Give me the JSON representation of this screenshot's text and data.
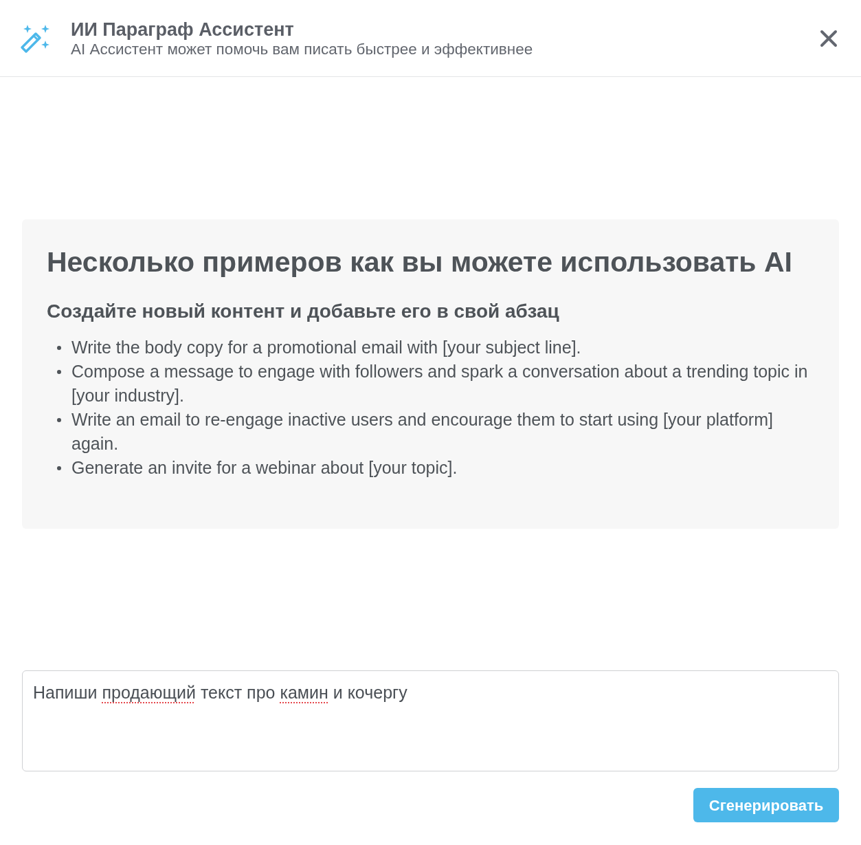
{
  "header": {
    "title": "ИИ Параграф Ассистент",
    "subtitle": "AI Ассистент может помочь вам писать быстрее и эффективнее"
  },
  "examples": {
    "title": "Несколько примеров как вы можете использовать AI",
    "subtitle": "Создайте новый контент и добавьте его в свой абзац",
    "items": [
      "Write the body copy for a promotional email with [your subject line].",
      "Compose a message to engage with followers and spark a conversation about a trending topic in [your industry].",
      "Write an email to re-engage inactive users and encourage them to start using [your platform] again.",
      "Generate an invite for a webinar about [your topic]."
    ]
  },
  "prompt": {
    "value": [
      {
        "text": "Напиши ",
        "misspelled": false
      },
      {
        "text": "продающий",
        "misspelled": true
      },
      {
        "text": " текст про ",
        "misspelled": false
      },
      {
        "text": "камин",
        "misspelled": true
      },
      {
        "text": " и кочергу",
        "misspelled": false
      }
    ]
  },
  "generate_button": {
    "label": "Сгенерировать"
  }
}
